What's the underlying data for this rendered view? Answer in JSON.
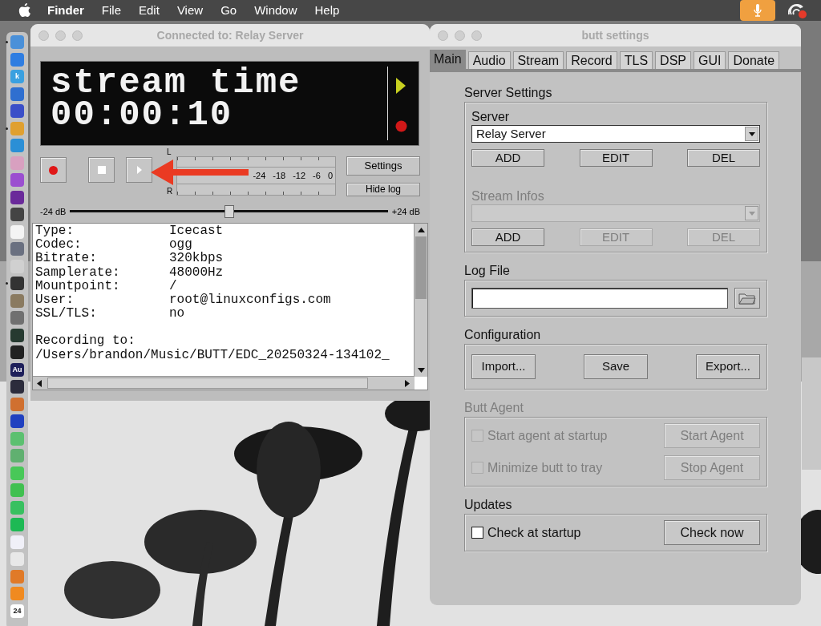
{
  "menubar": {
    "items": [
      {
        "label": "Finder",
        "kind": "app"
      },
      {
        "label": "File",
        "kind": "menu"
      },
      {
        "label": "Edit",
        "kind": "menu"
      },
      {
        "label": "View",
        "kind": "menu"
      },
      {
        "label": "Go",
        "kind": "menu"
      },
      {
        "label": "Window",
        "kind": "menu"
      },
      {
        "label": "Help",
        "kind": "menu"
      }
    ]
  },
  "dock": [
    {
      "color": "#4a90d9",
      "running": true
    },
    {
      "color": "#2f7de1",
      "running": false
    },
    {
      "color": "#3aa0e0",
      "running": false,
      "label": "k"
    },
    {
      "color": "#2f6fd0",
      "running": false
    },
    {
      "color": "#3b4fc8",
      "running": false
    },
    {
      "color": "#e0a030",
      "running": true
    },
    {
      "color": "#2b8fd6",
      "running": false
    },
    {
      "color": "#d8a0c0",
      "running": false
    },
    {
      "color": "#9b4fd0",
      "running": false
    },
    {
      "color": "#6a2a9a",
      "running": false
    },
    {
      "color": "#444444",
      "running": false
    },
    {
      "color": "#f4f4f4",
      "running": false
    },
    {
      "color": "#6a7080",
      "running": false
    },
    {
      "color": "#d0d0d0",
      "running": false
    },
    {
      "color": "#333333",
      "running": true
    },
    {
      "color": "#8a7a60",
      "running": false
    },
    {
      "color": "#707070",
      "running": false
    },
    {
      "color": "#263a30",
      "running": false
    },
    {
      "color": "#222222",
      "running": false
    },
    {
      "color": "#1e1f5a",
      "running": false,
      "label": "Au"
    },
    {
      "color": "#2c2c3c",
      "running": false
    },
    {
      "color": "#d07030",
      "running": false
    },
    {
      "color": "#2040c0",
      "running": false
    },
    {
      "color": "#5cc070",
      "running": false
    },
    {
      "color": "#60b070",
      "running": false
    },
    {
      "color": "#48c858",
      "running": false
    },
    {
      "color": "#40c050",
      "running": false
    },
    {
      "color": "#38c060",
      "running": false
    },
    {
      "color": "#1db954",
      "running": false
    },
    {
      "color": "#f0f0f8",
      "running": false
    },
    {
      "color": "#e8e8e8",
      "running": false
    },
    {
      "color": "#e07a28",
      "running": false
    },
    {
      "color": "#f08a20",
      "running": false
    },
    {
      "color": "#ffffff",
      "running": false,
      "label": "24"
    }
  ],
  "player_window": {
    "title": "Connected to: Relay Server",
    "display": {
      "lines": [
        "stream time",
        "00:00:10"
      ]
    },
    "vu_meter": {
      "channels": [
        "L",
        "R"
      ],
      "scale": [
        "-24",
        "-18",
        "-12",
        "-6",
        "0"
      ]
    },
    "side_buttons": [
      "Settings",
      "Hide log"
    ],
    "gain": {
      "min_label": "-24 dB",
      "max_label": "+24 dB",
      "level": 0.5
    },
    "log": {
      "fields": [
        {
          "key": "Type:",
          "value": "Icecast"
        },
        {
          "key": "Codec:",
          "value": "ogg"
        },
        {
          "key": "Bitrate:",
          "value": "320kbps"
        },
        {
          "key": "Samplerate:",
          "value": "48000Hz"
        },
        {
          "key": "Mountpoint:",
          "value": "/"
        },
        {
          "key": "User:",
          "value": "root@linuxconfigs.com"
        },
        {
          "key": "SSL/TLS:",
          "value": "no"
        }
      ],
      "lines": [
        "Recording to:",
        "/Users/brandon/Music/BUTT/EDC_20250324-134102_"
      ]
    }
  },
  "settings_window": {
    "title": "butt settings",
    "tabs": [
      {
        "label": "Main",
        "selected": true
      },
      {
        "label": "Audio",
        "selected": false
      },
      {
        "label": "Stream",
        "selected": false
      },
      {
        "label": "Record",
        "selected": false
      },
      {
        "label": "TLS",
        "selected": false
      },
      {
        "label": "DSP",
        "selected": false
      },
      {
        "label": "GUI",
        "selected": false
      },
      {
        "label": "Donate",
        "selected": false
      }
    ],
    "sections": [
      {
        "title": "Server Settings",
        "disabled": false,
        "rows": [
          {
            "kind": "label",
            "text": "Server",
            "disabled": false
          },
          {
            "kind": "dropdown",
            "value": "Relay Server",
            "disabled": false
          },
          {
            "kind": "buttons",
            "buttons": [
              {
                "label": "ADD",
                "disabled": false
              },
              {
                "label": "EDIT",
                "disabled": false
              },
              {
                "label": "DEL",
                "disabled": false
              }
            ]
          },
          {
            "kind": "label",
            "text": "Stream Infos",
            "disabled": true
          },
          {
            "kind": "dropdown",
            "disabled": true
          },
          {
            "kind": "buttons",
            "buttons": [
              {
                "label": "ADD",
                "disabled": false
              },
              {
                "label": "EDIT",
                "disabled": true
              },
              {
                "label": "DEL",
                "disabled": true
              }
            ]
          }
        ]
      },
      {
        "title": "Log File",
        "disabled": false,
        "rows": [
          {
            "kind": "file_input"
          }
        ]
      },
      {
        "title": "Configuration",
        "disabled": false,
        "rows": [
          {
            "kind": "big_buttons",
            "buttons": [
              {
                "label": "Import...",
                "disabled": false
              },
              {
                "label": "Save",
                "disabled": false
              },
              {
                "label": "Export...",
                "disabled": false
              }
            ]
          }
        ]
      },
      {
        "title": "Butt Agent",
        "disabled": true,
        "rows": [
          {
            "kind": "check_button",
            "label": "Start agent at startup",
            "checked": false,
            "disabled": true,
            "button": {
              "label": "Start Agent",
              "disabled": true
            }
          },
          {
            "kind": "check_button",
            "label": "Minimize butt to tray",
            "checked": false,
            "disabled": true,
            "button": {
              "label": "Stop Agent",
              "disabled": true
            }
          }
        ]
      },
      {
        "title": "Updates",
        "disabled": false,
        "rows": [
          {
            "kind": "check_button",
            "label": "Check at startup",
            "checked": false,
            "disabled": false,
            "button": {
              "label": "Check now",
              "disabled": false
            }
          }
        ]
      }
    ]
  }
}
